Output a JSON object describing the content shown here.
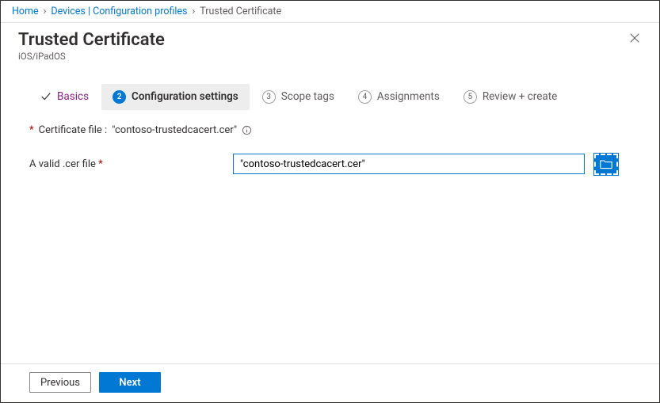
{
  "breadcrumb": {
    "home": "Home",
    "devices": "Devices | Configuration profiles",
    "current": "Trusted Certificate"
  },
  "header": {
    "title": "Trusted Certificate",
    "subtitle": "iOS/iPadOS"
  },
  "wizard": {
    "steps": [
      {
        "label": "Basics"
      },
      {
        "num": "2",
        "label": "Configuration settings"
      },
      {
        "num": "3",
        "label": "Scope tags"
      },
      {
        "num": "4",
        "label": "Assignments"
      },
      {
        "num": "5",
        "label": "Review + create"
      }
    ]
  },
  "form": {
    "cert_file_label_prefix": "Certificate file : ",
    "cert_file_name": "\"contoso-trustedcacert.cer\"",
    "valid_file_label": "A valid .cer file ",
    "file_input_value": "\"contoso-trustedcacert.cer\""
  },
  "footer": {
    "previous": "Previous",
    "next": "Next"
  }
}
